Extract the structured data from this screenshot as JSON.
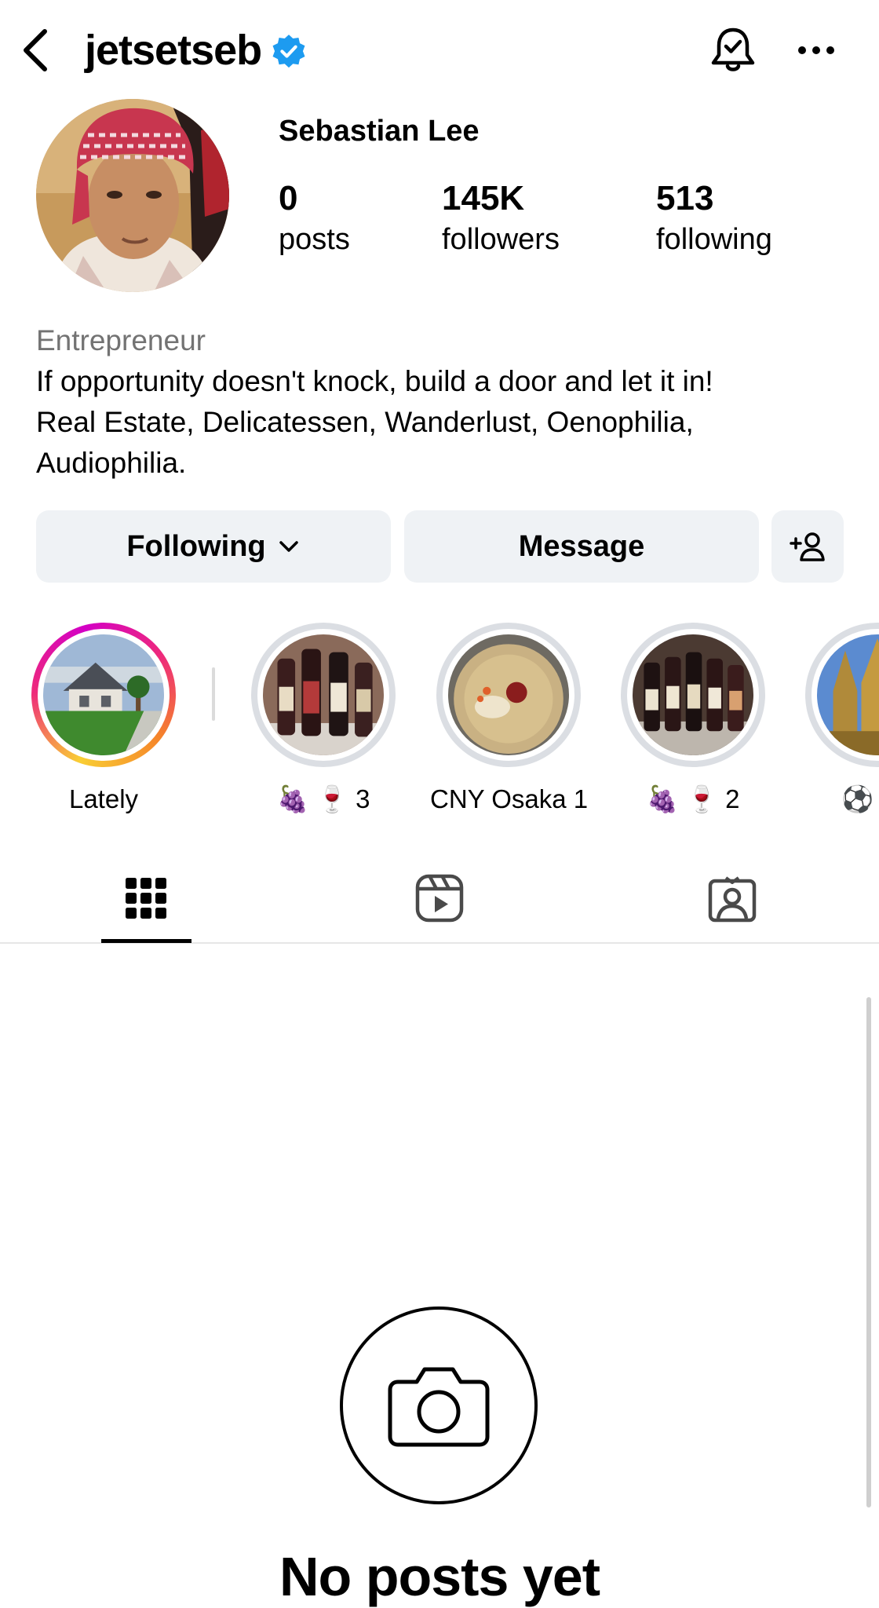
{
  "header": {
    "username": "jetsetseb",
    "verified": true,
    "icons": {
      "back": "chevron-left-icon",
      "verified": "verified-badge-icon",
      "notifications": "bell-check-icon",
      "more": "more-horizontal-icon"
    }
  },
  "profile": {
    "display_name": "Sebastian Lee",
    "stats": {
      "posts": {
        "value": "0",
        "label": "posts"
      },
      "followers": {
        "value": "145K",
        "label": "followers"
      },
      "following": {
        "value": "513",
        "label": "following"
      }
    },
    "bio": {
      "category": "Entrepreneur",
      "lines": [
        "If opportunity doesn't knock, build a door and let it in!",
        "Real Estate, Delicatessen, Wanderlust, Oenophilia,",
        "Audiophilia."
      ]
    }
  },
  "actions": {
    "following_label": "Following",
    "message_label": "Message",
    "add_user_icon": "add-user-icon"
  },
  "highlights": [
    {
      "label": "Lately",
      "ring": "story"
    },
    {
      "label": "🍇 🍷 3",
      "ring": "gray"
    },
    {
      "label": "CNY Osaka 1",
      "ring": "gray"
    },
    {
      "label": "🍇 🍷 2",
      "ring": "gray"
    },
    {
      "label": "⚽ 🌭",
      "ring": "gray"
    }
  ],
  "tabs": [
    {
      "icon": "grid-icon",
      "active": true
    },
    {
      "icon": "reels-icon",
      "active": false
    },
    {
      "icon": "tagged-icon",
      "active": false
    }
  ],
  "empty_state": {
    "icon": "camera-icon",
    "title": "No posts yet"
  },
  "colors": {
    "verified_blue": "#1d9bf0",
    "button_bg": "#eff2f5",
    "muted_text": "#737373"
  }
}
